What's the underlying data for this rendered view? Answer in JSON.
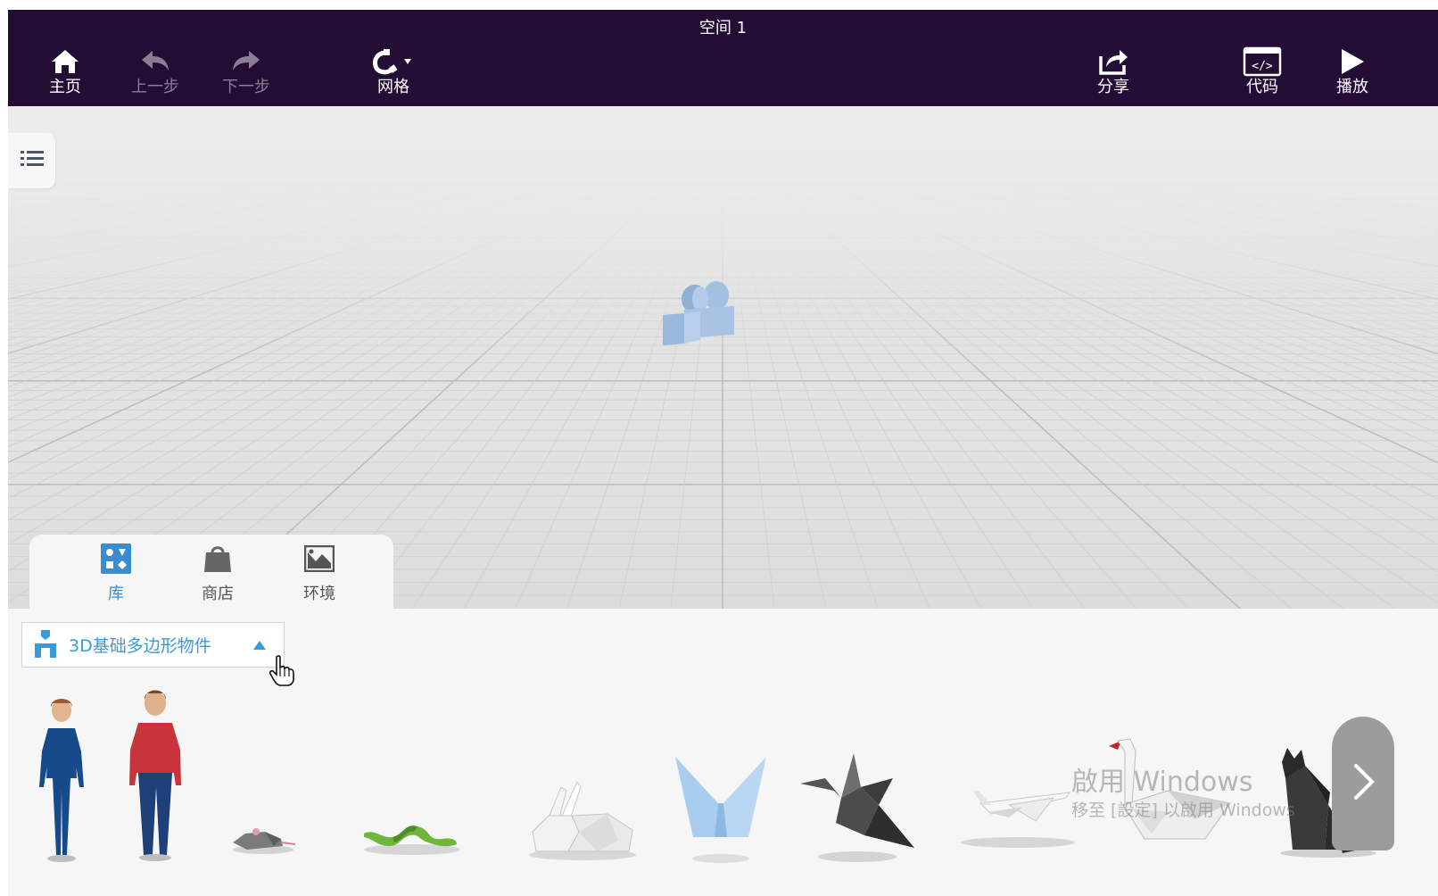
{
  "title": "空间 1",
  "toolbar": {
    "home_label": "主页",
    "undo_label": "上一步",
    "redo_label": "下一步",
    "grid_label": "网格",
    "share_label": "分享",
    "code_label": "代码",
    "play_label": "播放"
  },
  "library_tabs": [
    {
      "label": "库",
      "icon": "library-icon",
      "active": true
    },
    {
      "label": "商店",
      "icon": "store-bag-icon",
      "active": false
    },
    {
      "label": "环境",
      "icon": "environment-image-icon",
      "active": false
    }
  ],
  "category_dropdown": {
    "label": "3D基础多边形物件"
  },
  "models": [
    "female-character",
    "male-character",
    "mouse",
    "snake",
    "rabbit",
    "butterfly",
    "crane-bird",
    "airplane",
    "swan",
    "cat"
  ],
  "watermark": {
    "line1": "啟用 Windows",
    "line2": "移至 [設定] 以啟用 Windows"
  },
  "colors": {
    "topbar": "#230d35",
    "accent": "#3a8bcf",
    "camera": "#a9c4e2"
  }
}
